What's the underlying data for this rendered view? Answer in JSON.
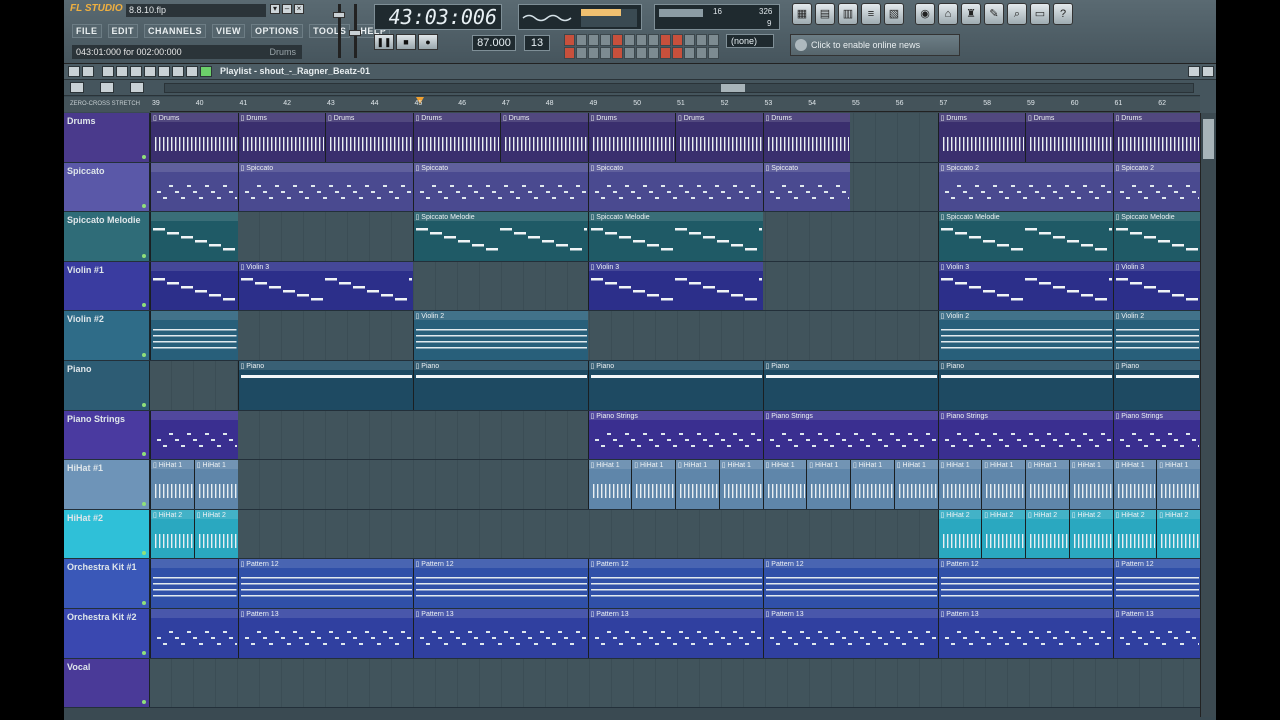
{
  "app": {
    "logo": "FL STUDIO",
    "file_name": "8.8.10.flp",
    "menu": [
      "FILE",
      "EDIT",
      "CHANNELS",
      "VIEW",
      "OPTIONS",
      "TOOLS",
      "HELP"
    ],
    "hint": "043:01:000 for 002:00:000",
    "hint_value": "Drums",
    "time": "43:03:006",
    "tempo": "87.000",
    "pattern": "13",
    "snap": "(none)",
    "cpu_value": "16",
    "cpu_mem": "326",
    "poly": "9",
    "news": "Click to enable online news",
    "transport": [
      "❚❚",
      "■",
      "●"
    ],
    "panel_icons": [
      "▦",
      "▤",
      "▥",
      "≡",
      "▧",
      "◉",
      "⌂",
      "♜",
      "✎",
      "⌕",
      "▭",
      "?"
    ]
  },
  "playlist": {
    "title": "Playlist - shout_-_Ragner_Beatz-01",
    "ruler_left": "ZERO-CROSS  STRETCH",
    "bars": [
      "39",
      "40",
      "41",
      "42",
      "43",
      "44",
      "45",
      "46",
      "47",
      "48",
      "49",
      "50",
      "51",
      "52",
      "53",
      "54",
      "55",
      "56",
      "57",
      "58",
      "59",
      "60",
      "61",
      "62"
    ]
  },
  "tracks": [
    {
      "name": "Drums",
      "color": "#4a3a8c",
      "lane": "#3a2f6e",
      "clips": [
        {
          "label": "Drums",
          "s": 0,
          "l": 1
        },
        {
          "label": "Drums",
          "s": 1,
          "l": 1
        },
        {
          "label": "Drums",
          "s": 2,
          "l": 1
        },
        {
          "label": "Drums",
          "s": 3,
          "l": 1
        },
        {
          "label": "Drums",
          "s": 4,
          "l": 1
        },
        {
          "label": "Drums",
          "s": 5,
          "l": 1
        },
        {
          "label": "Drums",
          "s": 6,
          "l": 1
        },
        {
          "label": "Drums",
          "s": 7,
          "l": 1
        },
        {
          "label": "Drums",
          "s": 9,
          "l": 1
        },
        {
          "label": "Drums",
          "s": 10,
          "l": 1
        },
        {
          "label": "Drums",
          "s": 11,
          "l": 1
        }
      ],
      "style": "ticks"
    },
    {
      "name": "Spiccato",
      "color": "#5a58a8",
      "lane": "#4a4a90",
      "clips": [
        {
          "label": "",
          "s": 0,
          "l": 1
        },
        {
          "label": "Spiccato",
          "s": 1,
          "l": 2
        },
        {
          "label": "Spiccato",
          "s": 3,
          "l": 2
        },
        {
          "label": "Spiccato",
          "s": 5,
          "l": 2
        },
        {
          "label": "Spiccato",
          "s": 7,
          "l": 1
        },
        {
          "label": "Spiccato 2",
          "s": 9,
          "l": 2
        },
        {
          "label": "Spiccato 2",
          "s": 11,
          "l": 1
        }
      ],
      "style": "dots"
    },
    {
      "name": "Spiccato Melodie",
      "color": "#2f6c78",
      "lane": "#1f5a66",
      "clips": [
        {
          "label": "",
          "s": 0,
          "l": 1
        },
        {
          "label": "Spiccato Melodie",
          "s": 3,
          "l": 2
        },
        {
          "label": "Spiccato Melodie",
          "s": 5,
          "l": 2
        },
        {
          "label": "Spiccato Melodie",
          "s": 9,
          "l": 2
        },
        {
          "label": "Spiccato Melodie",
          "s": 11,
          "l": 1
        }
      ],
      "style": "stairs"
    },
    {
      "name": "Violin #1",
      "color": "#3a3ca0",
      "lane": "#2c2f8a",
      "clips": [
        {
          "label": "",
          "s": 0,
          "l": 1
        },
        {
          "label": "Violin 3",
          "s": 1,
          "l": 2
        },
        {
          "label": "Violin 3",
          "s": 5,
          "l": 2
        },
        {
          "label": "Violin 3",
          "s": 9,
          "l": 2
        },
        {
          "label": "Violin 3",
          "s": 11,
          "l": 1
        }
      ],
      "style": "stairs"
    },
    {
      "name": "Violin #2",
      "color": "#2f6c88",
      "lane": "#285f7a",
      "clips": [
        {
          "label": "",
          "s": 0,
          "l": 1
        },
        {
          "label": "Violin 2",
          "s": 3,
          "l": 2
        },
        {
          "label": "Violin 2",
          "s": 9,
          "l": 2
        },
        {
          "label": "Violin 2",
          "s": 11,
          "l": 1
        }
      ],
      "style": "lines"
    },
    {
      "name": "Piano",
      "color": "#2d5c74",
      "lane": "#1e4a62",
      "clips": [
        {
          "label": "Piano",
          "s": 1,
          "l": 2
        },
        {
          "label": "Piano",
          "s": 3,
          "l": 2
        },
        {
          "label": "Piano",
          "s": 5,
          "l": 2
        },
        {
          "label": "Piano",
          "s": 7,
          "l": 2
        },
        {
          "label": "Piano",
          "s": 9,
          "l": 2
        },
        {
          "label": "Piano",
          "s": 11,
          "l": 1
        }
      ],
      "style": "bar"
    },
    {
      "name": "Piano Strings",
      "color": "#4a3aa0",
      "lane": "#3a2f90",
      "clips": [
        {
          "label": "",
          "s": 0,
          "l": 1
        },
        {
          "label": "Piano Strings",
          "s": 5,
          "l": 2
        },
        {
          "label": "Piano Strings",
          "s": 7,
          "l": 2
        },
        {
          "label": "Piano Strings",
          "s": 9,
          "l": 2
        },
        {
          "label": "Piano Strings",
          "s": 11,
          "l": 1
        }
      ],
      "style": "dots"
    },
    {
      "name": "HiHat #1",
      "color": "#6e94b8",
      "lane": "#5f86aa",
      "clips": [
        {
          "label": "HiHat 1",
          "s": 0,
          "l": 0.5
        },
        {
          "label": "HiHat 1",
          "s": 0.5,
          "l": 0.5
        },
        {
          "label": "HiHat 1",
          "s": 5,
          "l": 0.5
        },
        {
          "label": "HiHat 1",
          "s": 5.5,
          "l": 0.5
        },
        {
          "label": "HiHat 1",
          "s": 6,
          "l": 0.5
        },
        {
          "label": "HiHat 1",
          "s": 6.5,
          "l": 0.5
        },
        {
          "label": "HiHat 1",
          "s": 7,
          "l": 0.5
        },
        {
          "label": "HiHat 1",
          "s": 7.5,
          "l": 0.5
        },
        {
          "label": "HiHat 1",
          "s": 8,
          "l": 0.5
        },
        {
          "label": "HiHat 1",
          "s": 8.5,
          "l": 0.5
        },
        {
          "label": "HiHat 1",
          "s": 9,
          "l": 0.5
        },
        {
          "label": "HiHat 1",
          "s": 9.5,
          "l": 0.5
        },
        {
          "label": "HiHat 1",
          "s": 10,
          "l": 0.5
        },
        {
          "label": "HiHat 1",
          "s": 10.5,
          "l": 0.5
        },
        {
          "label": "HiHat 1",
          "s": 11,
          "l": 0.5
        },
        {
          "label": "HiHat 1",
          "s": 11.5,
          "l": 0.5
        }
      ],
      "style": "ticks"
    },
    {
      "name": "HiHat #2",
      "color": "#2fc0d8",
      "lane": "#2aa8c0",
      "clips": [
        {
          "label": "HiHat 2",
          "s": 0,
          "l": 0.5
        },
        {
          "label": "HiHat 2",
          "s": 0.5,
          "l": 0.5
        },
        {
          "label": "HiHat 2",
          "s": 9,
          "l": 0.5
        },
        {
          "label": "HiHat 2",
          "s": 9.5,
          "l": 0.5
        },
        {
          "label": "HiHat 2",
          "s": 10,
          "l": 0.5
        },
        {
          "label": "HiHat 2",
          "s": 10.5,
          "l": 0.5
        },
        {
          "label": "HiHat 2",
          "s": 11,
          "l": 0.5
        },
        {
          "label": "HiHat 2",
          "s": 11.5,
          "l": 0.5
        }
      ],
      "style": "ticks"
    },
    {
      "name": "Orchestra Kit #1",
      "color": "#3a58b8",
      "lane": "#3050a8",
      "clips": [
        {
          "label": "",
          "s": 0,
          "l": 1
        },
        {
          "label": "Pattern 12",
          "s": 1,
          "l": 2
        },
        {
          "label": "Pattern 12",
          "s": 3,
          "l": 2
        },
        {
          "label": "Pattern 12",
          "s": 5,
          "l": 2
        },
        {
          "label": "Pattern 12",
          "s": 7,
          "l": 2
        },
        {
          "label": "Pattern 12",
          "s": 9,
          "l": 2
        },
        {
          "label": "Pattern 12",
          "s": 11,
          "l": 1
        }
      ],
      "style": "lines"
    },
    {
      "name": "Orchestra Kit #2",
      "color": "#3a48b0",
      "lane": "#3040a0",
      "clips": [
        {
          "label": "",
          "s": 0,
          "l": 1
        },
        {
          "label": "Pattern 13",
          "s": 1,
          "l": 2
        },
        {
          "label": "Pattern 13",
          "s": 3,
          "l": 2
        },
        {
          "label": "Pattern 13",
          "s": 5,
          "l": 2
        },
        {
          "label": "Pattern 13",
          "s": 7,
          "l": 2
        },
        {
          "label": "Pattern 13",
          "s": 9,
          "l": 2
        },
        {
          "label": "Pattern 13",
          "s": 11,
          "l": 1
        }
      ],
      "style": "dots"
    },
    {
      "name": "Vocal",
      "color": "#4a3a98",
      "lane": "",
      "clips": [],
      "style": ""
    }
  ]
}
